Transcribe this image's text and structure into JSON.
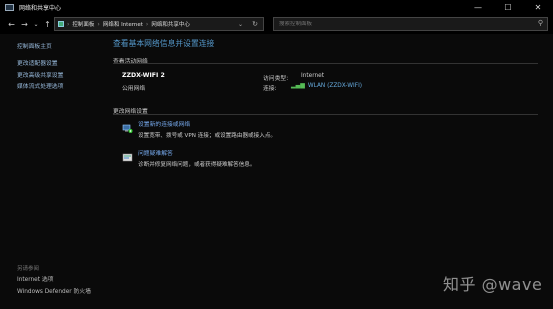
{
  "window": {
    "title": "网络和共享中心",
    "minimize": "—",
    "maximize": "☐",
    "close": "✕"
  },
  "nav": {
    "back": "←",
    "forward": "→",
    "recent": "⌄",
    "up": "↑",
    "breadcrumbs": [
      "控制面板",
      "网络和 Internet",
      "网络和共享中心"
    ],
    "refresh": "↻",
    "dropdown": "⌄"
  },
  "search": {
    "placeholder": "搜索控制面板"
  },
  "sidebar": {
    "items": [
      "控制面板主页",
      "更改适配器设置",
      "更改高级共享设置",
      "媒体流式处理选项"
    ],
    "see_also_label": "另请参阅",
    "see_also": [
      "Internet 选项",
      "Windows Defender 防火墙"
    ]
  },
  "main": {
    "title": "查看基本网络信息并设置连接",
    "active_networks_label": "查看活动网络",
    "network": {
      "name": "ZZDX-WIFI 2",
      "category": "公用网络",
      "access_type_label": "访问类型:",
      "access_type_value": "Internet",
      "connections_label": "连接:",
      "connection_value": "WLAN (ZZDX-WIFI)"
    },
    "change_settings_label": "更改网络设置",
    "tasks": [
      {
        "icon": "network-setup-icon",
        "title": "设置新的连接或网络",
        "desc": "设置宽带、拨号或 VPN 连接；或设置路由器或接入点。"
      },
      {
        "icon": "troubleshoot-icon",
        "title": "问题疑难解答",
        "desc": "诊断并修复网络问题，或者获得疑难解答信息。"
      }
    ]
  },
  "watermark": "知乎 @wave",
  "colors": {
    "accent": "#5599cc",
    "link": "#77aaee",
    "background": "#0a0a0a"
  }
}
